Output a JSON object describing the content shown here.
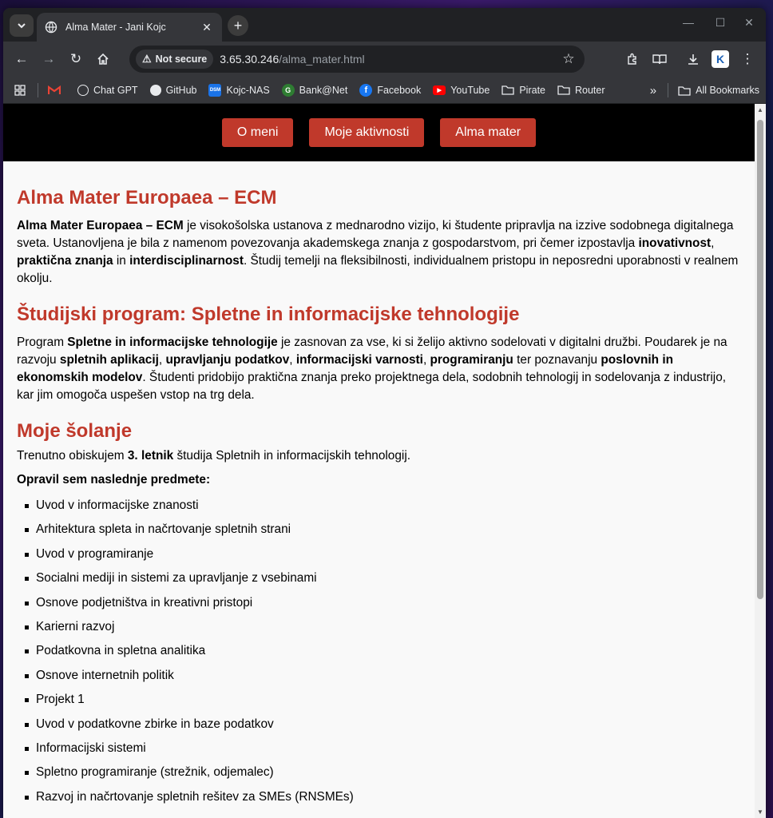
{
  "browser": {
    "tab_title": "Alma Mater - Jani Kojc",
    "security_label": "Not secure",
    "url_host": "3.65.30.246",
    "url_path": "/alma_mater.html",
    "bookmarks": [
      "Chat GPT",
      "GitHub",
      "Kojc-NAS",
      "Bank@Net",
      "Facebook",
      "YouTube",
      "Pirate",
      "Router"
    ],
    "all_bookmarks": "All Bookmarks",
    "profile_initial": "K"
  },
  "nav": {
    "items": [
      "O meni",
      "Moje aktivnosti",
      "Alma mater"
    ]
  },
  "section1": {
    "heading": "Alma Mater Europaea – ECM",
    "p_b1": "Alma Mater Europaea – ECM",
    "p_t1": " je visokošolska ustanova z mednarodno vizijo, ki študente pripravlja na izzive sodobnega digitalnega sveta. Ustanovljena je bila z namenom povezovanja akademskega znanja z gospodarstvom, pri čemer izpostavlja ",
    "p_b2": "inovativnost",
    "p_t2": ", ",
    "p_b3": "praktična znanja",
    "p_t3": " in ",
    "p_b4": "interdisciplinarnost",
    "p_t4": ". Študij temelji na fleksibilnosti, individualnem pristopu in neposredni uporabnosti v realnem okolju."
  },
  "section2": {
    "heading": "Študijski program: Spletne in informacijske tehnologije",
    "p_t0": "Program ",
    "p_b1": "Spletne in informacijske tehnologije",
    "p_t1": " je zasnovan za vse, ki si želijo aktivno sodelovati v digitalni družbi. Poudarek je na razvoju ",
    "p_b2": "spletnih aplikacij",
    "p_t2": ", ",
    "p_b3": "upravljanju podatkov",
    "p_t3": ", ",
    "p_b4": "informacijski varnosti",
    "p_t4": ", ",
    "p_b5": "programiranju",
    "p_t5": " ter poznavanju ",
    "p_b6": "poslovnih in ekonomskih modelov",
    "p_t6": ". Študenti pridobijo praktična znanja preko projektnega dela, sodobnih tehnologij in sodelovanja z industrijo, kar jim omogoča uspešen vstop na trg dela."
  },
  "section3": {
    "heading": "Moje šolanje",
    "p_t0": "Trenutno obiskujem ",
    "p_b1": "3. letnik",
    "p_t1": " študija Spletnih in informacijskih tehnologij.",
    "subjects_label": "Opravil sem naslednje predmete:",
    "subjects": [
      "Uvod v informacijske znanosti",
      "Arhitektura spleta in načrtovanje spletnih strani",
      "Uvod v programiranje",
      "Socialni mediji in sistemi za upravljanje z vsebinami",
      "Osnove podjetništva in kreativni pristopi",
      "Karierni razvoj",
      "Podatkovna in spletna analitika",
      "Osnove internetnih politik",
      "Projekt 1",
      "Uvod v podatkovne zbirke in baze podatkov",
      "Informacijski sistemi",
      "Spletno programiranje (strežnik, odjemalec)",
      "Razvoj in načrtovanje spletnih rešitev za SMEs (RNSMEs)"
    ]
  },
  "colors": {
    "accent": "#c0392b",
    "nav_bg": "#000000",
    "page_bg": "#f9f9f9"
  }
}
